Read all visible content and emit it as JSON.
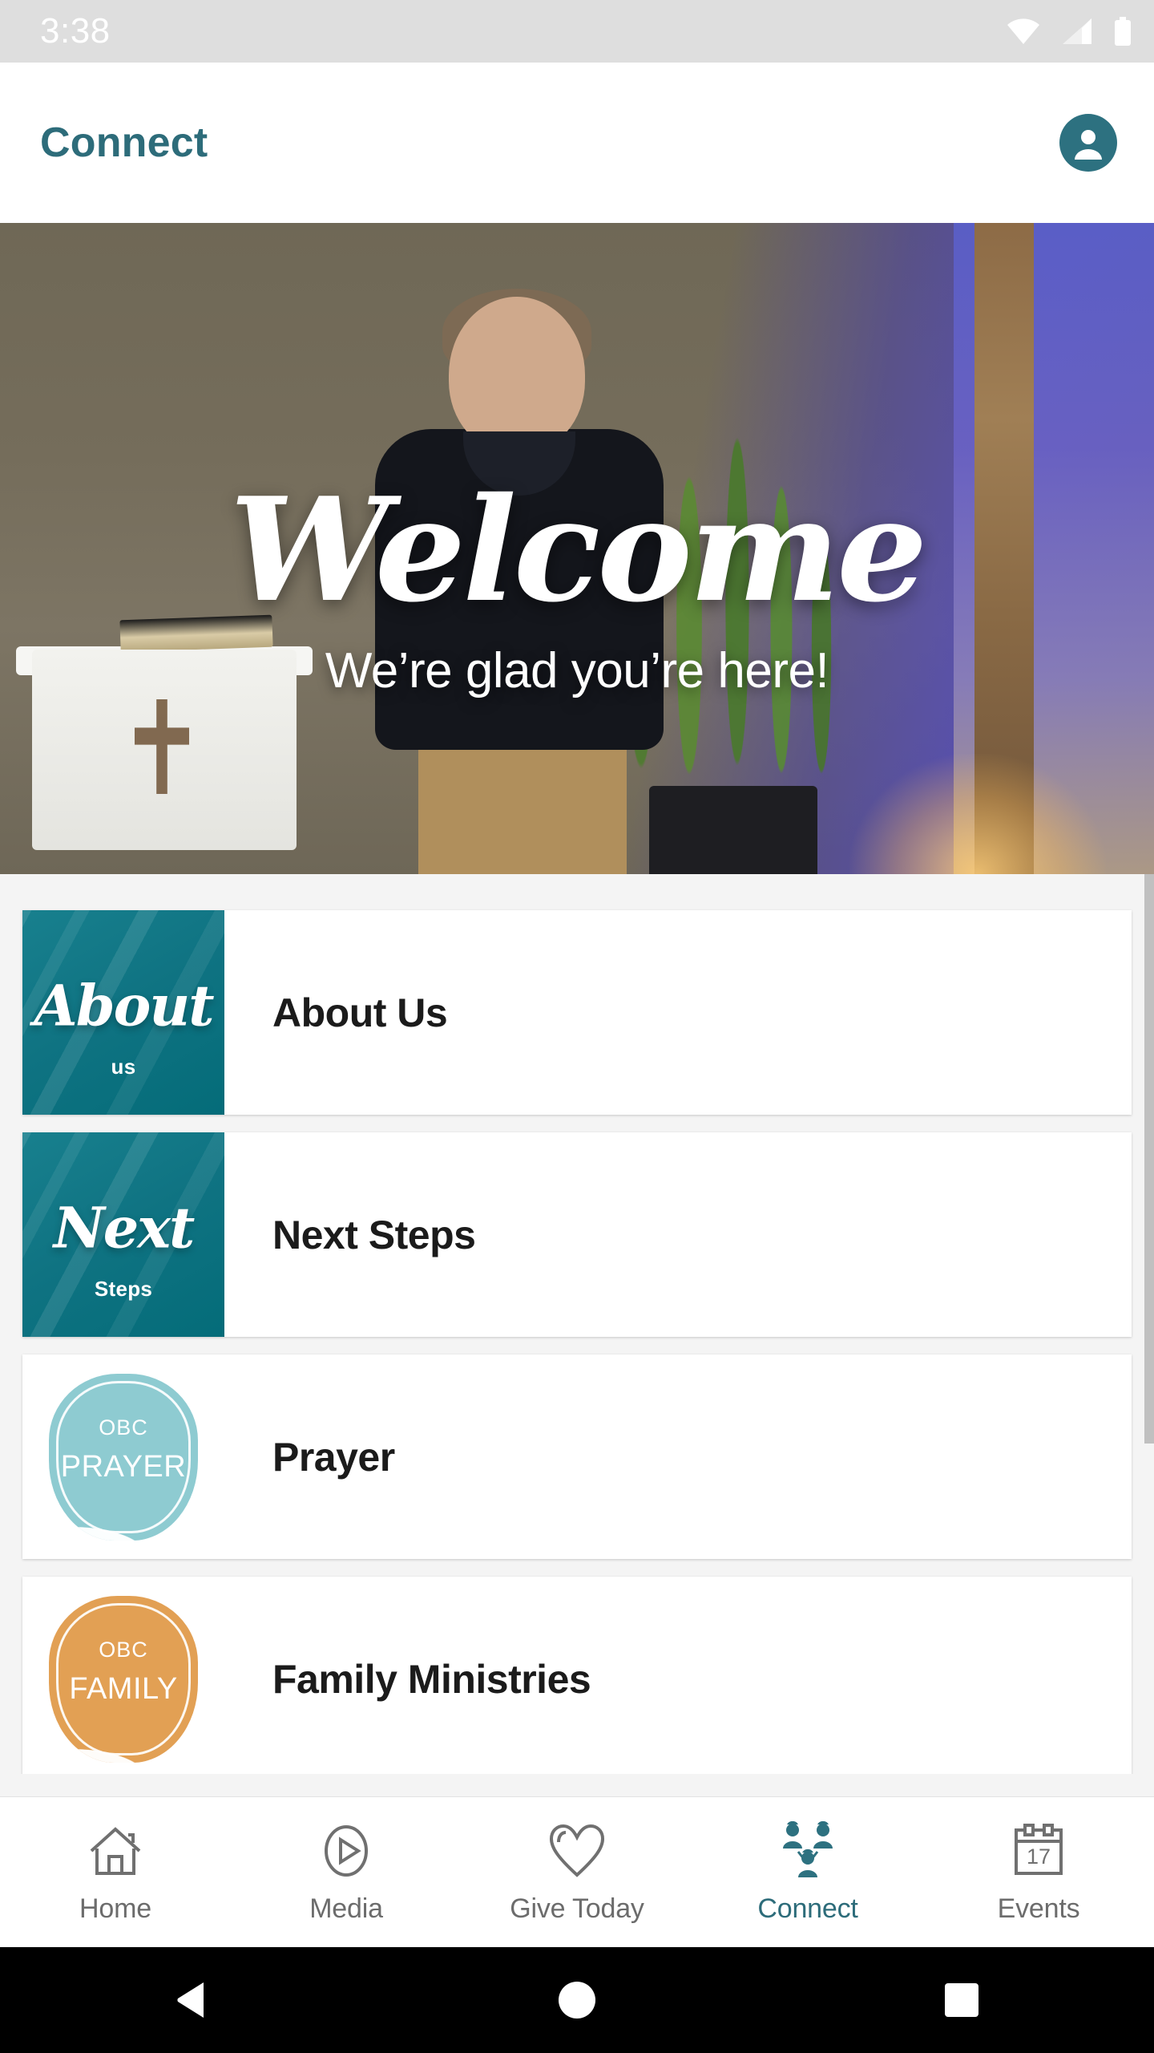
{
  "status_bar": {
    "time": "3:38",
    "icons": [
      "wifi-icon",
      "cellular-signal-icon",
      "battery-icon"
    ]
  },
  "app_bar": {
    "title": "Connect",
    "account_icon": "account-avatar-icon",
    "accent_color": "#2d6c7a"
  },
  "hero": {
    "title": "Welcome",
    "subtitle": "We’re glad you’re here!"
  },
  "list": {
    "items": [
      {
        "label": "About Us",
        "thumb_type": "teal-script",
        "thumb_script": "About",
        "thumb_sub": "us",
        "thumb_color": "#0f7382"
      },
      {
        "label": "Next Steps",
        "thumb_type": "teal-script",
        "thumb_script": "Next",
        "thumb_sub": "Steps",
        "thumb_color": "#0f7382"
      },
      {
        "label": "Prayer",
        "thumb_type": "badge",
        "badge_top": "OBC",
        "badge_word": "PRAYER",
        "thumb_color": "#8ecbd1"
      },
      {
        "label": "Family Ministries",
        "thumb_type": "badge",
        "badge_top": "OBC",
        "badge_word": "FAMILY",
        "thumb_color": "#e2a054"
      }
    ]
  },
  "tab_bar": {
    "active": "Connect",
    "tabs": [
      {
        "label": "Home",
        "icon": "home-icon"
      },
      {
        "label": "Media",
        "icon": "play-circle-icon"
      },
      {
        "label": "Give Today",
        "icon": "heart-icon"
      },
      {
        "label": "Connect",
        "icon": "people-group-icon"
      },
      {
        "label": "Events",
        "icon": "calendar-icon"
      }
    ],
    "calendar_day": "17"
  },
  "nav_bar": {
    "buttons": [
      {
        "name": "back-button",
        "icon": "triangle-left-icon"
      },
      {
        "name": "home-button",
        "icon": "circle-icon"
      },
      {
        "name": "recents-button",
        "icon": "square-icon"
      }
    ]
  }
}
